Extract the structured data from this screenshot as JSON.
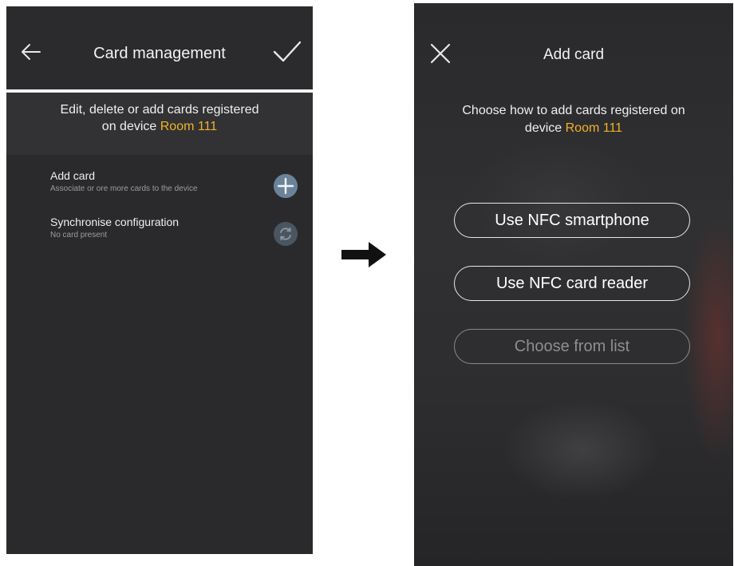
{
  "left_screen": {
    "header": {
      "title": "Card management",
      "back_icon": "arrow-left-icon",
      "confirm_icon": "checkmark-icon"
    },
    "info": {
      "line1": "Edit, delete or add cards registered",
      "line2_prefix": "on device ",
      "device": "Room 111"
    },
    "items": [
      {
        "title": "Add card",
        "subtitle": "Associate or ore more cards to the device",
        "icon": "plus-icon"
      },
      {
        "title": "Synchronise configuration",
        "subtitle": "No card present",
        "icon": "sync-icon"
      }
    ]
  },
  "arrow_icon": "arrow-right-icon",
  "right_screen": {
    "header": {
      "title": "Add card",
      "close_icon": "close-icon"
    },
    "info": {
      "line1": "Choose how to add cards registered on",
      "line2_prefix": "device ",
      "device": "Room 111"
    },
    "buttons": [
      {
        "label": "Use NFC smartphone",
        "enabled": true
      },
      {
        "label": "Use NFC card reader",
        "enabled": true
      },
      {
        "label": "Choose from list",
        "enabled": false
      }
    ]
  },
  "colors": {
    "accent": "#f0b229",
    "background": "#2a2a2c",
    "text": "#f0f0f0",
    "add_icon_bg": "#6b8398",
    "sync_icon_bg": "#4a5560"
  }
}
